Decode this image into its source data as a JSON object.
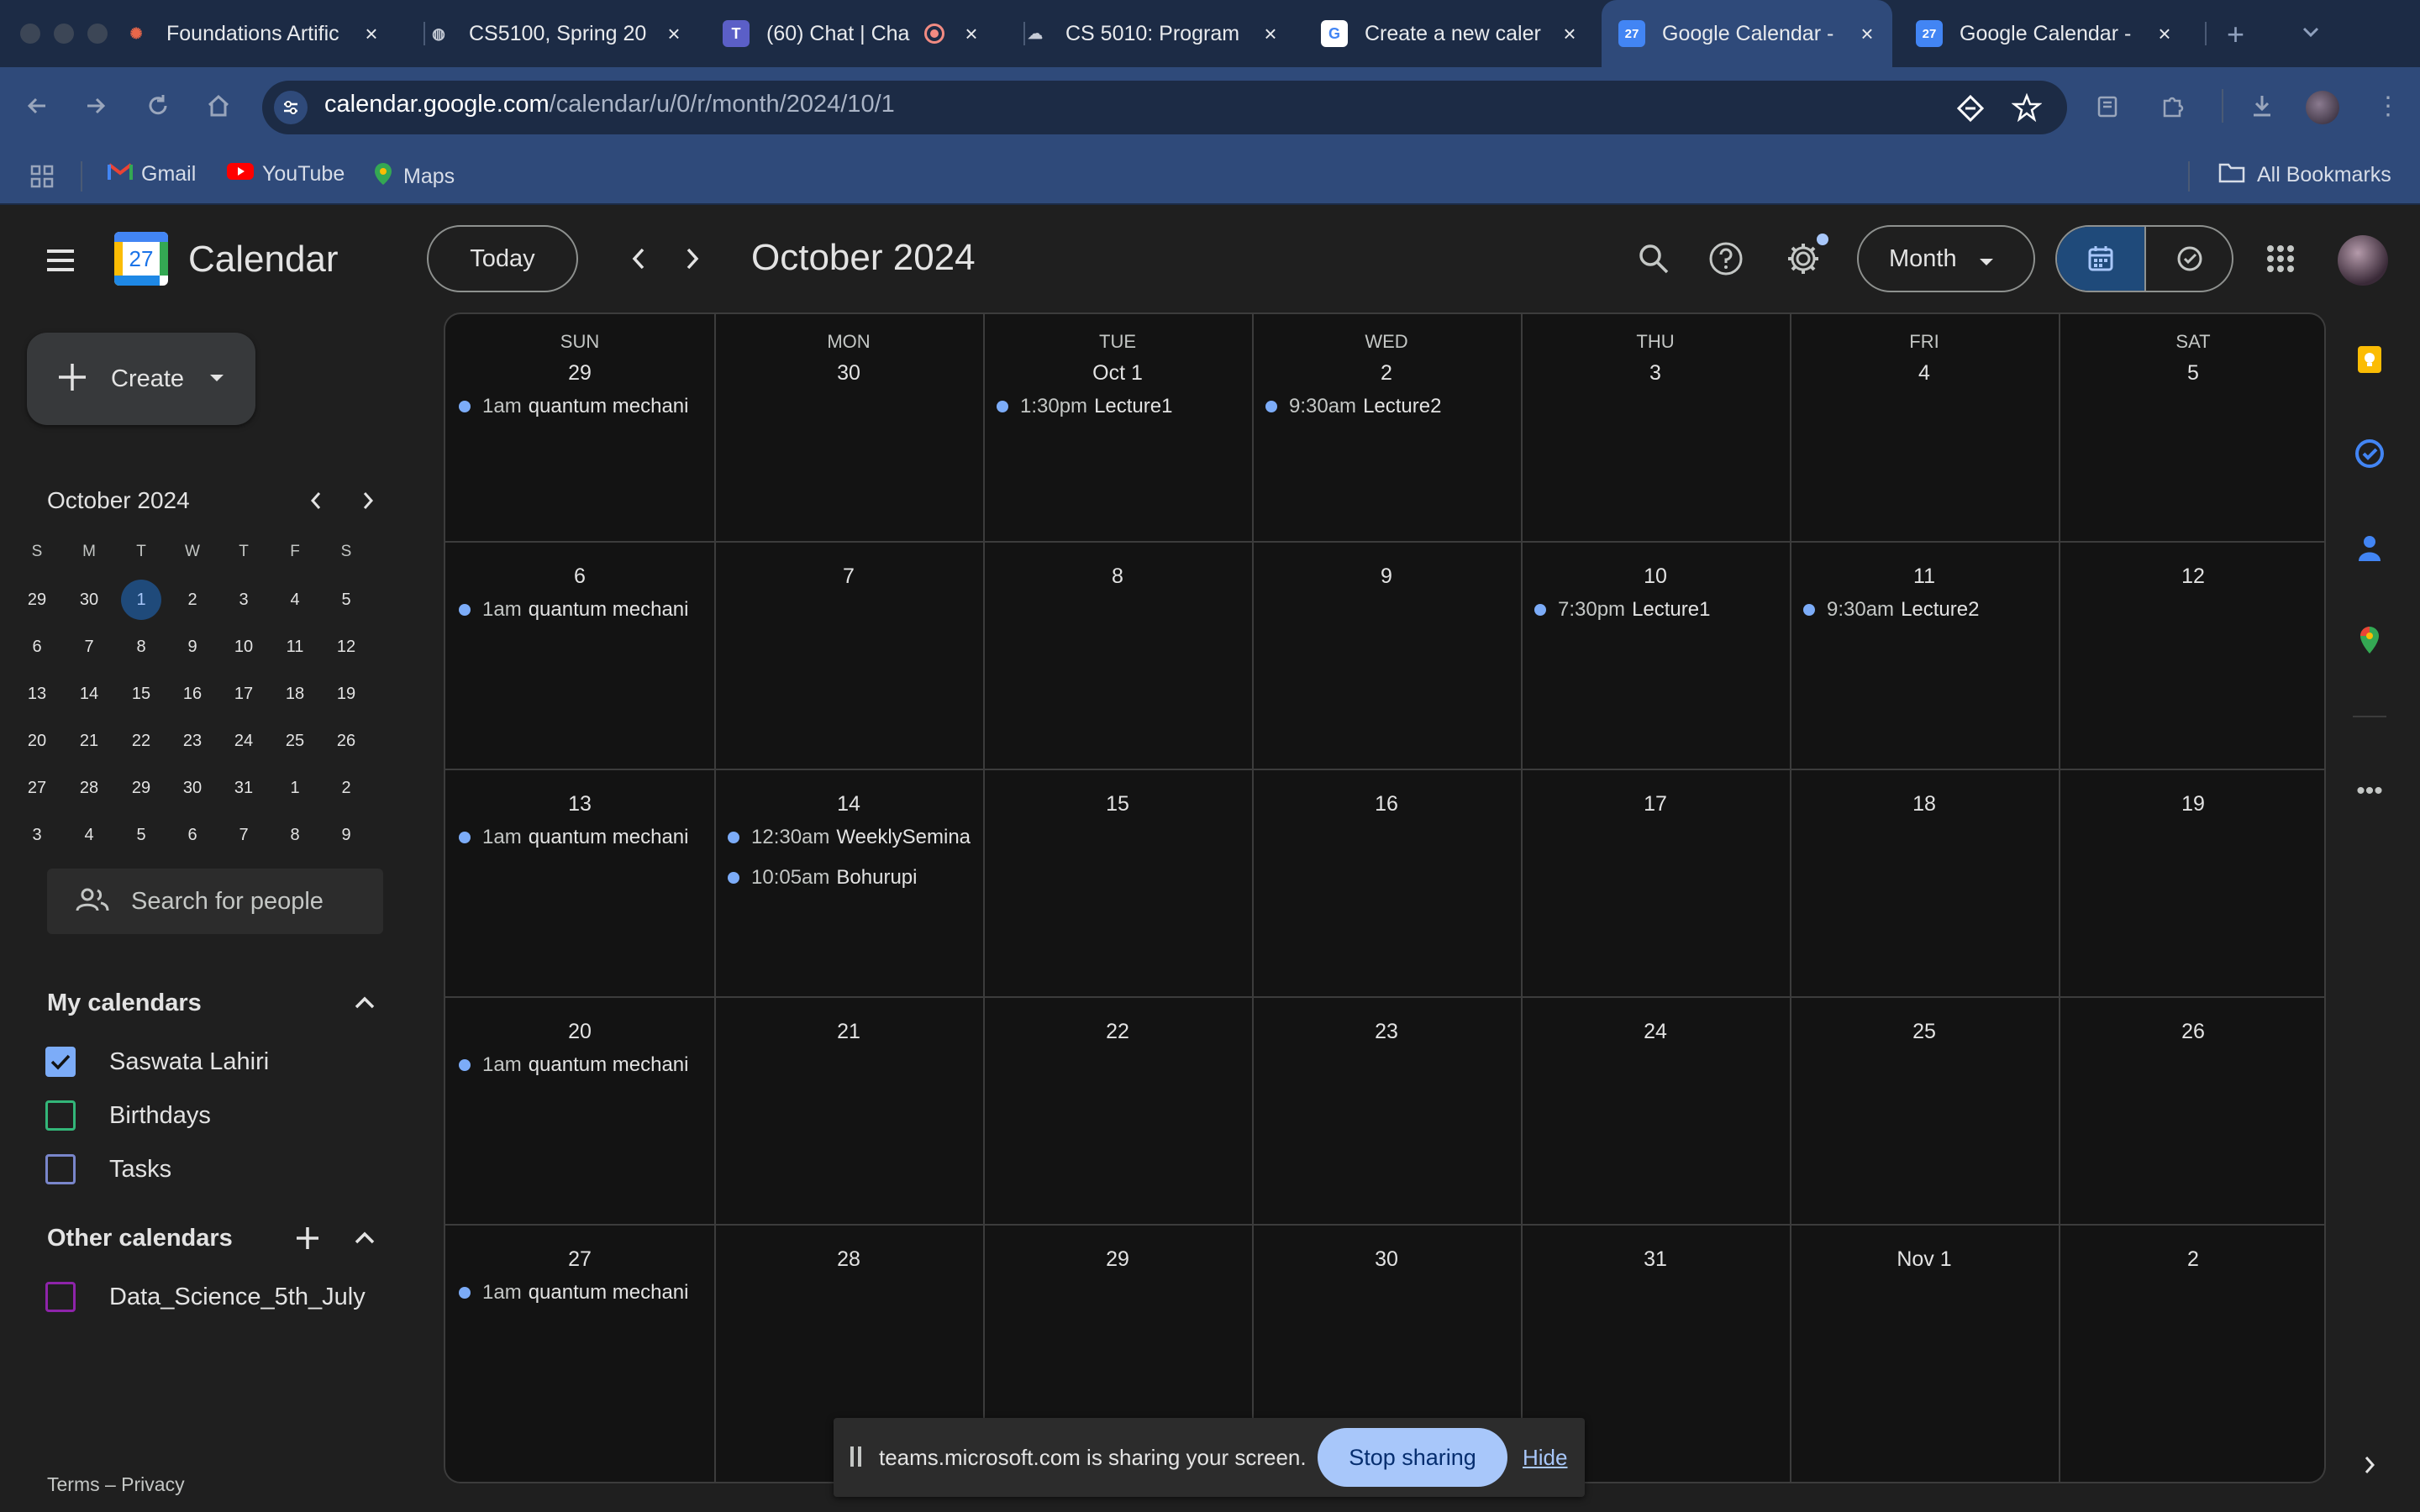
{
  "browser": {
    "tabs": [
      {
        "title": "Foundations Artific",
        "icon": "openai-knot-icon",
        "active": false
      },
      {
        "title": "CS5100, Spring 20",
        "icon": "globe-icon",
        "active": false
      },
      {
        "title": "(60) Chat | Cha",
        "icon": "teams-icon",
        "active": false
      },
      {
        "title": "CS 5010: Program",
        "icon": "cloud-icon",
        "active": false
      },
      {
        "title": "Create a new caler",
        "icon": "google-g-icon",
        "active": false
      },
      {
        "title": "Google Calendar -",
        "icon": "calendar-favicon",
        "active": true
      },
      {
        "title": "Google Calendar -",
        "icon": "calendar-favicon",
        "active": false
      }
    ],
    "url_host": "calendar.google.com",
    "url_path": "/calendar/u/0/r/month/2024/10/1",
    "bookmarks": [
      {
        "label": "Gmail",
        "icon": "gmail-icon"
      },
      {
        "label": "YouTube",
        "icon": "youtube-icon"
      },
      {
        "label": "Maps",
        "icon": "maps-icon"
      }
    ],
    "all_bookmarks": "All Bookmarks"
  },
  "header": {
    "app_name": "Calendar",
    "logo_day": "27",
    "today_label": "Today",
    "current_period": "October 2024",
    "view_label": "Month"
  },
  "sidebar": {
    "create_label": "Create",
    "mini_cal": {
      "title": "October 2024",
      "weekday_heads": [
        "S",
        "M",
        "T",
        "W",
        "T",
        "F",
        "S"
      ],
      "weeks": [
        [
          "29",
          "30",
          "1",
          "2",
          "3",
          "4",
          "5"
        ],
        [
          "6",
          "7",
          "8",
          "9",
          "10",
          "11",
          "12"
        ],
        [
          "13",
          "14",
          "15",
          "16",
          "17",
          "18",
          "19"
        ],
        [
          "20",
          "21",
          "22",
          "23",
          "24",
          "25",
          "26"
        ],
        [
          "27",
          "28",
          "29",
          "30",
          "31",
          "1",
          "2"
        ],
        [
          "3",
          "4",
          "5",
          "6",
          "7",
          "8",
          "9"
        ]
      ],
      "today": "1"
    },
    "search_people": "Search for people",
    "my_calendars_title": "My calendars",
    "my_calendars": [
      {
        "name": "Saswata Lahiri",
        "checked": true,
        "color": "#7cacf8"
      },
      {
        "name": "Birthdays",
        "checked": false,
        "color": "#33b679"
      },
      {
        "name": "Tasks",
        "checked": false,
        "color": "#7986cb"
      }
    ],
    "other_calendars_title": "Other calendars",
    "other_calendars": [
      {
        "name": "Data_Science_5th_July",
        "checked": false,
        "color": "#8e24aa"
      }
    ],
    "footer": "Terms – Privacy"
  },
  "month": {
    "weekdays": [
      "SUN",
      "MON",
      "TUE",
      "WED",
      "THU",
      "FRI",
      "SAT"
    ],
    "weeks": [
      [
        {
          "day": "29",
          "events": [
            {
              "time": "1am",
              "title": "quantum mechani"
            }
          ]
        },
        {
          "day": "30",
          "events": []
        },
        {
          "day": "Oct 1",
          "events": [
            {
              "time": "1:30pm",
              "title": "Lecture1"
            }
          ]
        },
        {
          "day": "2",
          "events": [
            {
              "time": "9:30am",
              "title": "Lecture2"
            }
          ]
        },
        {
          "day": "3",
          "events": []
        },
        {
          "day": "4",
          "events": []
        },
        {
          "day": "5",
          "events": []
        }
      ],
      [
        {
          "day": "6",
          "events": [
            {
              "time": "1am",
              "title": "quantum mechani"
            }
          ]
        },
        {
          "day": "7",
          "events": []
        },
        {
          "day": "8",
          "events": []
        },
        {
          "day": "9",
          "events": []
        },
        {
          "day": "10",
          "events": [
            {
              "time": "7:30pm",
              "title": "Lecture1"
            }
          ]
        },
        {
          "day": "11",
          "events": [
            {
              "time": "9:30am",
              "title": "Lecture2"
            }
          ]
        },
        {
          "day": "12",
          "events": []
        }
      ],
      [
        {
          "day": "13",
          "events": [
            {
              "time": "1am",
              "title": "quantum mechani"
            }
          ]
        },
        {
          "day": "14",
          "events": [
            {
              "time": "12:30am",
              "title": "WeeklySemina"
            },
            {
              "time": "10:05am",
              "title": "Bohurupi"
            }
          ]
        },
        {
          "day": "15",
          "events": []
        },
        {
          "day": "16",
          "events": []
        },
        {
          "day": "17",
          "events": []
        },
        {
          "day": "18",
          "events": []
        },
        {
          "day": "19",
          "events": []
        }
      ],
      [
        {
          "day": "20",
          "events": [
            {
              "time": "1am",
              "title": "quantum mechani"
            }
          ]
        },
        {
          "day": "21",
          "events": []
        },
        {
          "day": "22",
          "events": []
        },
        {
          "day": "23",
          "events": []
        },
        {
          "day": "24",
          "events": []
        },
        {
          "day": "25",
          "events": []
        },
        {
          "day": "26",
          "events": []
        }
      ],
      [
        {
          "day": "27",
          "events": [
            {
              "time": "1am",
              "title": "quantum mechani"
            }
          ]
        },
        {
          "day": "28",
          "events": []
        },
        {
          "day": "29",
          "events": []
        },
        {
          "day": "30",
          "events": []
        },
        {
          "day": "31",
          "events": []
        },
        {
          "day": "Nov 1",
          "events": []
        },
        {
          "day": "2",
          "events": []
        }
      ]
    ]
  },
  "share_bar": {
    "message": "teams.microsoft.com is sharing your screen.",
    "stop_label": "Stop sharing",
    "hide_label": "Hide"
  },
  "colors": {
    "accent": "#a8c7fa",
    "event_dot": "#7cacf8",
    "today_circle": "#1f4a7a"
  }
}
